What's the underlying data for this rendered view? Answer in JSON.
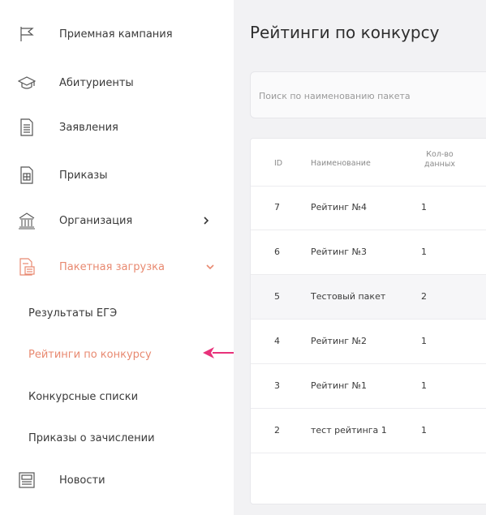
{
  "sidebar": {
    "items": [
      {
        "label": "Приемная кампания",
        "icon": "flag-icon"
      },
      {
        "label": "Абитуриенты",
        "icon": "graduation-cap-icon"
      },
      {
        "label": "Заявления",
        "icon": "document-icon"
      },
      {
        "label": "Приказы",
        "icon": "order-document-icon"
      },
      {
        "label": "Организация",
        "icon": "building-icon"
      },
      {
        "label": "Пакетная загрузка",
        "icon": "package-upload-icon"
      }
    ],
    "submenu": [
      {
        "label": "Результаты ЕГЭ"
      },
      {
        "label": "Рейтинги по конкурсу"
      },
      {
        "label": "Конкурсные списки"
      },
      {
        "label": "Приказы о зачислении"
      }
    ],
    "bottom": {
      "label": "Новости",
      "icon": "newspaper-icon"
    },
    "active_color": "#e88970",
    "annotation_arrow_color": "#e8317a"
  },
  "main": {
    "title": "Рейтинги по конкурсу",
    "search": {
      "placeholder": "Поиск по наименованию пакета",
      "value": ""
    },
    "table": {
      "columns": {
        "id": "ID",
        "name": "Наименование",
        "count_line1": "Кол-во",
        "count_line2": "данных"
      },
      "rows": [
        {
          "id": "7",
          "name": "Рейтинг №4",
          "count": "1"
        },
        {
          "id": "6",
          "name": "Рейтинг №3",
          "count": "1"
        },
        {
          "id": "5",
          "name": "Тестовый пакет",
          "count": "2"
        },
        {
          "id": "4",
          "name": "Рейтинг №2",
          "count": "1"
        },
        {
          "id": "3",
          "name": "Рейтинг №1",
          "count": "1"
        },
        {
          "id": "2",
          "name": "тест рейтинга 1",
          "count": "1"
        }
      ]
    }
  }
}
